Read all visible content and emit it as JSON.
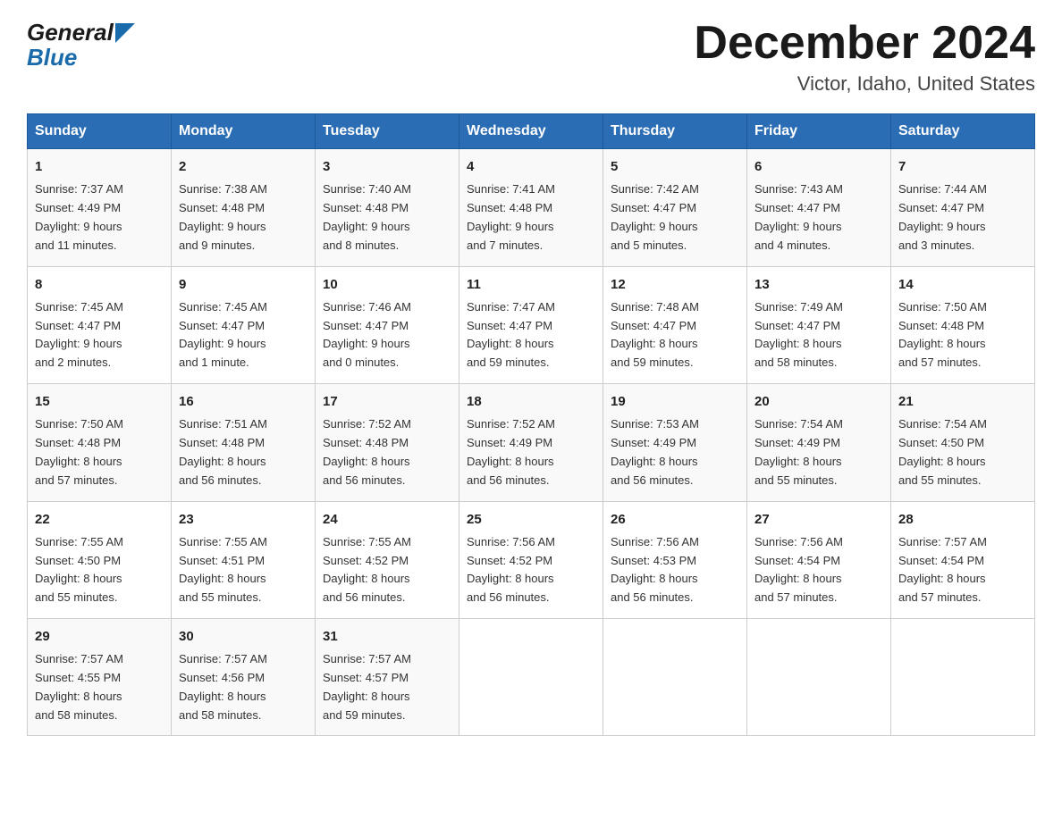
{
  "logo": {
    "general": "General",
    "blue": "Blue"
  },
  "title": "December 2024",
  "location": "Victor, Idaho, United States",
  "days_of_week": [
    "Sunday",
    "Monday",
    "Tuesday",
    "Wednesday",
    "Thursday",
    "Friday",
    "Saturday"
  ],
  "weeks": [
    [
      {
        "day": "1",
        "sunrise": "7:37 AM",
        "sunset": "4:49 PM",
        "daylight": "9 hours and 11 minutes."
      },
      {
        "day": "2",
        "sunrise": "7:38 AM",
        "sunset": "4:48 PM",
        "daylight": "9 hours and 9 minutes."
      },
      {
        "day": "3",
        "sunrise": "7:40 AM",
        "sunset": "4:48 PM",
        "daylight": "9 hours and 8 minutes."
      },
      {
        "day": "4",
        "sunrise": "7:41 AM",
        "sunset": "4:48 PM",
        "daylight": "9 hours and 7 minutes."
      },
      {
        "day": "5",
        "sunrise": "7:42 AM",
        "sunset": "4:47 PM",
        "daylight": "9 hours and 5 minutes."
      },
      {
        "day": "6",
        "sunrise": "7:43 AM",
        "sunset": "4:47 PM",
        "daylight": "9 hours and 4 minutes."
      },
      {
        "day": "7",
        "sunrise": "7:44 AM",
        "sunset": "4:47 PM",
        "daylight": "9 hours and 3 minutes."
      }
    ],
    [
      {
        "day": "8",
        "sunrise": "7:45 AM",
        "sunset": "4:47 PM",
        "daylight": "9 hours and 2 minutes."
      },
      {
        "day": "9",
        "sunrise": "7:45 AM",
        "sunset": "4:47 PM",
        "daylight": "9 hours and 1 minute."
      },
      {
        "day": "10",
        "sunrise": "7:46 AM",
        "sunset": "4:47 PM",
        "daylight": "9 hours and 0 minutes."
      },
      {
        "day": "11",
        "sunrise": "7:47 AM",
        "sunset": "4:47 PM",
        "daylight": "8 hours and 59 minutes."
      },
      {
        "day": "12",
        "sunrise": "7:48 AM",
        "sunset": "4:47 PM",
        "daylight": "8 hours and 59 minutes."
      },
      {
        "day": "13",
        "sunrise": "7:49 AM",
        "sunset": "4:47 PM",
        "daylight": "8 hours and 58 minutes."
      },
      {
        "day": "14",
        "sunrise": "7:50 AM",
        "sunset": "4:48 PM",
        "daylight": "8 hours and 57 minutes."
      }
    ],
    [
      {
        "day": "15",
        "sunrise": "7:50 AM",
        "sunset": "4:48 PM",
        "daylight": "8 hours and 57 minutes."
      },
      {
        "day": "16",
        "sunrise": "7:51 AM",
        "sunset": "4:48 PM",
        "daylight": "8 hours and 56 minutes."
      },
      {
        "day": "17",
        "sunrise": "7:52 AM",
        "sunset": "4:48 PM",
        "daylight": "8 hours and 56 minutes."
      },
      {
        "day": "18",
        "sunrise": "7:52 AM",
        "sunset": "4:49 PM",
        "daylight": "8 hours and 56 minutes."
      },
      {
        "day": "19",
        "sunrise": "7:53 AM",
        "sunset": "4:49 PM",
        "daylight": "8 hours and 56 minutes."
      },
      {
        "day": "20",
        "sunrise": "7:54 AM",
        "sunset": "4:49 PM",
        "daylight": "8 hours and 55 minutes."
      },
      {
        "day": "21",
        "sunrise": "7:54 AM",
        "sunset": "4:50 PM",
        "daylight": "8 hours and 55 minutes."
      }
    ],
    [
      {
        "day": "22",
        "sunrise": "7:55 AM",
        "sunset": "4:50 PM",
        "daylight": "8 hours and 55 minutes."
      },
      {
        "day": "23",
        "sunrise": "7:55 AM",
        "sunset": "4:51 PM",
        "daylight": "8 hours and 55 minutes."
      },
      {
        "day": "24",
        "sunrise": "7:55 AM",
        "sunset": "4:52 PM",
        "daylight": "8 hours and 56 minutes."
      },
      {
        "day": "25",
        "sunrise": "7:56 AM",
        "sunset": "4:52 PM",
        "daylight": "8 hours and 56 minutes."
      },
      {
        "day": "26",
        "sunrise": "7:56 AM",
        "sunset": "4:53 PM",
        "daylight": "8 hours and 56 minutes."
      },
      {
        "day": "27",
        "sunrise": "7:56 AM",
        "sunset": "4:54 PM",
        "daylight": "8 hours and 57 minutes."
      },
      {
        "day": "28",
        "sunrise": "7:57 AM",
        "sunset": "4:54 PM",
        "daylight": "8 hours and 57 minutes."
      }
    ],
    [
      {
        "day": "29",
        "sunrise": "7:57 AM",
        "sunset": "4:55 PM",
        "daylight": "8 hours and 58 minutes."
      },
      {
        "day": "30",
        "sunrise": "7:57 AM",
        "sunset": "4:56 PM",
        "daylight": "8 hours and 58 minutes."
      },
      {
        "day": "31",
        "sunrise": "7:57 AM",
        "sunset": "4:57 PM",
        "daylight": "8 hours and 59 minutes."
      },
      null,
      null,
      null,
      null
    ]
  ],
  "labels": {
    "sunrise": "Sunrise:",
    "sunset": "Sunset:",
    "daylight": "Daylight:"
  },
  "colors": {
    "header_bg": "#2a6db5",
    "header_text": "#ffffff",
    "border": "#999999"
  }
}
